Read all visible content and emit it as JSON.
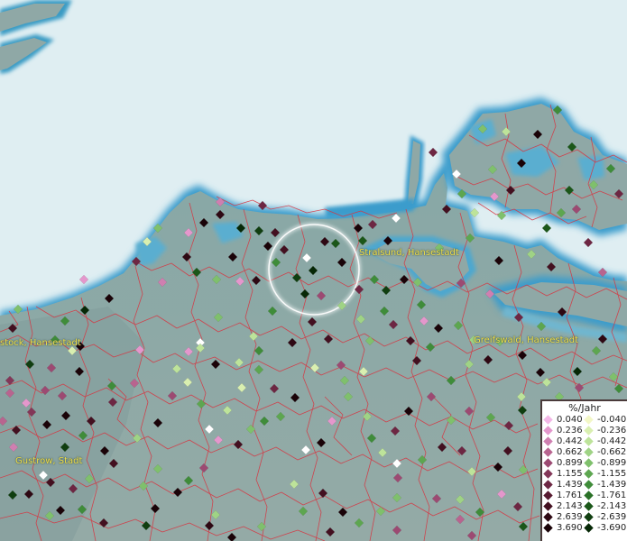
{
  "cities": [
    {
      "label": "Stralsund, Hansestadt"
    },
    {
      "label": "stock, Hansestadt"
    },
    {
      "label": "Greifswald, Hansestadt"
    },
    {
      "label": "Gustrow, Stadt"
    }
  ],
  "legend": {
    "title": "%/Jahr",
    "rows": [
      {
        "pos": "0.040",
        "pos_color": "#f3b7e6",
        "neg": "-0.040",
        "neg_color": "#f3f7c6"
      },
      {
        "pos": "0.236",
        "pos_color": "#e497cc",
        "neg": "-0.236",
        "neg_color": "#d9efb0"
      },
      {
        "pos": "0.442",
        "pos_color": "#cf7fb0",
        "neg": "-0.442",
        "neg_color": "#bde39a"
      },
      {
        "pos": "0.662",
        "pos_color": "#b8648f",
        "neg": "-0.662",
        "neg_color": "#9fd385"
      },
      {
        "pos": "0.899",
        "pos_color": "#9c4a72",
        "neg": "-0.899",
        "neg_color": "#7fc06c"
      },
      {
        "pos": "1.155",
        "pos_color": "#833758",
        "neg": "-1.155",
        "neg_color": "#5da650"
      },
      {
        "pos": "1.439",
        "pos_color": "#6d2743",
        "neg": "-1.439",
        "neg_color": "#3f8c3a"
      },
      {
        "pos": "1.761",
        "pos_color": "#571a30",
        "neg": "-1.761",
        "neg_color": "#2a7127"
      },
      {
        "pos": "2.143",
        "pos_color": "#431020",
        "neg": "-2.143",
        "neg_color": "#1b5719"
      },
      {
        "pos": "2.639",
        "pos_color": "#2e0813",
        "neg": "-2.639",
        "neg_color": "#103e10"
      },
      {
        "pos": "3.690",
        "pos_color": "#1a0308",
        "neg": "-3.690",
        "neg_color": "#062806"
      }
    ]
  },
  "colors": {
    "sea": "#dfeef2",
    "land": "#8fa8a6",
    "coast_glow": "#4fa3c6",
    "borders": "#d8333f",
    "label": "#f2e14a",
    "highlight_ring": "#ffffff"
  }
}
